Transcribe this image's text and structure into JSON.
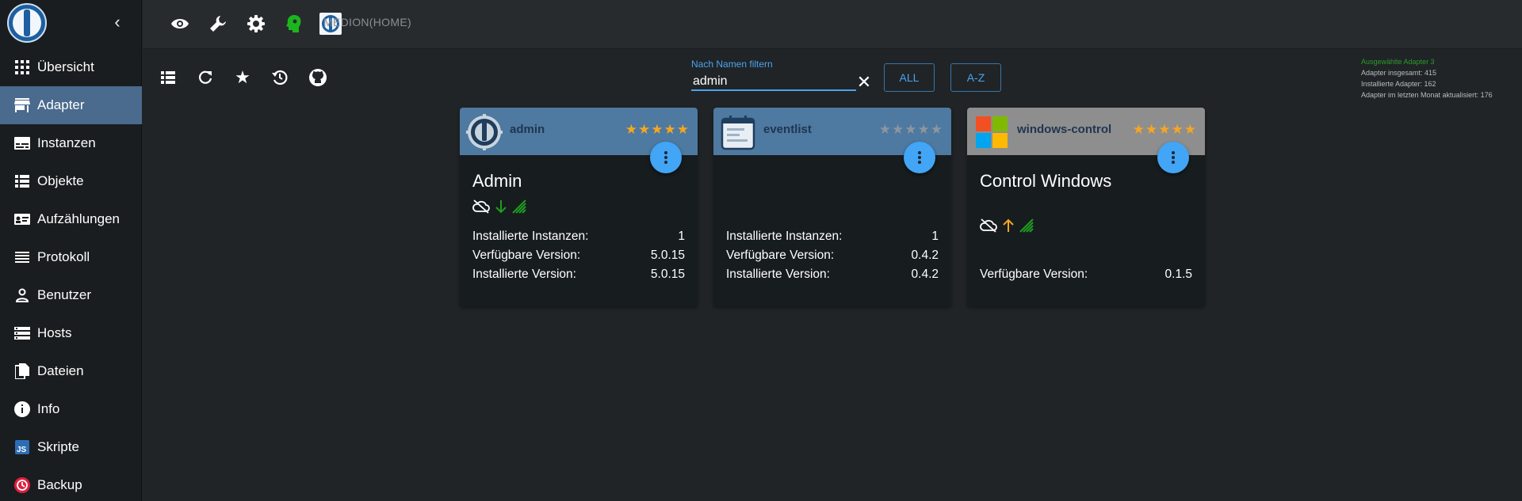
{
  "sidebar": {
    "items": [
      {
        "label": "Übersicht",
        "icon": "apps-icon"
      },
      {
        "label": "Adapter",
        "icon": "store-icon"
      },
      {
        "label": "Instanzen",
        "icon": "subtitles-icon"
      },
      {
        "label": "Objekte",
        "icon": "list-icon"
      },
      {
        "label": "Aufzählungen",
        "icon": "badge-icon"
      },
      {
        "label": "Protokoll",
        "icon": "menu-lines-icon"
      },
      {
        "label": "Benutzer",
        "icon": "person-icon"
      },
      {
        "label": "Hosts",
        "icon": "storage-icon"
      },
      {
        "label": "Dateien",
        "icon": "files-icon"
      },
      {
        "label": "Info",
        "icon": "info-icon"
      },
      {
        "label": "Skripte",
        "icon": "js-icon"
      },
      {
        "label": "Backup",
        "icon": "backup-icon"
      }
    ],
    "active": "Adapter"
  },
  "topbar": {
    "host": "MEDION(HOME)"
  },
  "filter": {
    "label": "Nach Namen filtern",
    "value": "admin"
  },
  "buttons": {
    "all": "ALL",
    "az": "A-Z"
  },
  "stats": {
    "selected": "Ausgewählte Adapter 3",
    "total": "Adapter insgesamt: 415",
    "installed": "Installierte Adapter: 162",
    "updated": "Adapter im letzten Monat aktualisiert: 176"
  },
  "cards": [
    {
      "name": "admin",
      "title": "Admin",
      "stars": "★★★★★",
      "star_color": "#f5a623",
      "head_color": "#4e79a0",
      "rows": [
        {
          "label": "Installierte Instanzen:",
          "value": "1"
        },
        {
          "label": "Verfügbare Version:",
          "value": "5.0.15"
        },
        {
          "label": "Installierte Version:",
          "value": "5.0.15"
        }
      ]
    },
    {
      "name": "eventlist",
      "title": "",
      "stars": "★★★★★",
      "star_color": "#8c96a0",
      "head_color": "#4e79a0",
      "rows": [
        {
          "label": "Installierte Instanzen:",
          "value": "1"
        },
        {
          "label": "Verfügbare Version:",
          "value": "0.4.2"
        },
        {
          "label": "Installierte Version:",
          "value": "0.4.2"
        }
      ]
    },
    {
      "name": "windows-control",
      "title": "Control Windows",
      "stars": "★★★★★",
      "star_color": "#f5a623",
      "head_color": "#8e8e8e",
      "rows": [
        {
          "label": "Verfügbare Version:",
          "value": "0.1.5"
        }
      ]
    }
  ]
}
